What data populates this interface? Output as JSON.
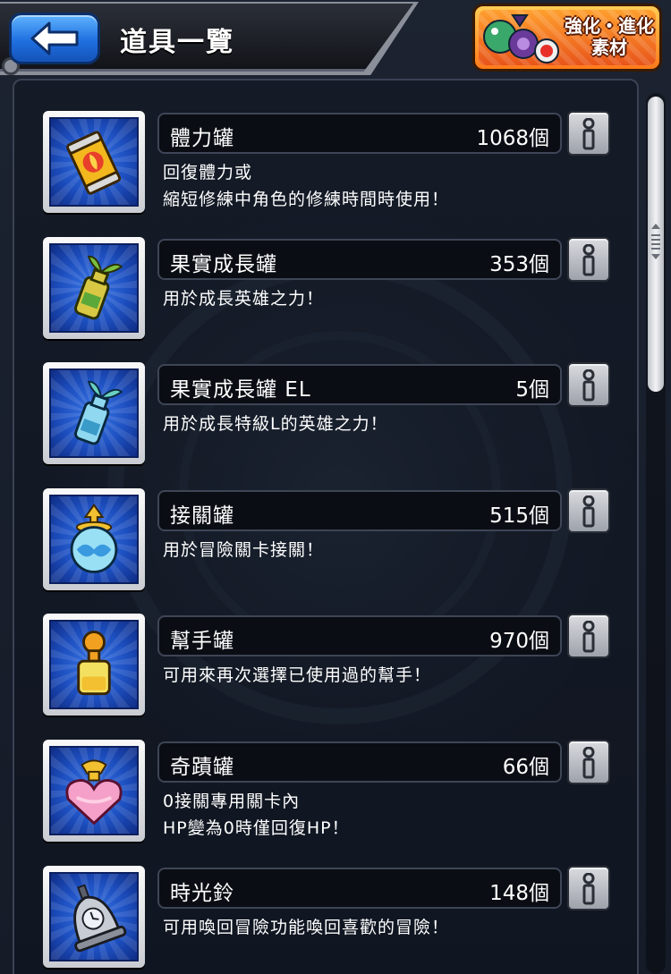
{
  "header": {
    "title": "道具一覽",
    "back_icon": "back-arrow-icon",
    "material_button": {
      "line1": "強化・進化",
      "line2": "素材"
    }
  },
  "items": [
    {
      "name": "體力罐",
      "count": "1068個",
      "desc": [
        "回復體力或",
        "縮短修練中角色的修練時間時使用！"
      ],
      "icon": "stamina-can-icon"
    },
    {
      "name": "果實成長罐",
      "count": "353個",
      "desc": [
        "用於成長英雄之力！"
      ],
      "icon": "fruit-growth-can-icon"
    },
    {
      "name": "果實成長罐 EL",
      "count": "5個",
      "desc": [
        "用於成長特級L的英雄之力！"
      ],
      "icon": "fruit-growth-can-el-icon"
    },
    {
      "name": "接關罐",
      "count": "515個",
      "desc": [
        "用於冒險關卡接關！"
      ],
      "icon": "continue-can-icon"
    },
    {
      "name": "幫手罐",
      "count": "970個",
      "desc": [
        "可用來再次選擇已使用過的幫手！"
      ],
      "icon": "helper-can-icon"
    },
    {
      "name": "奇蹟罐",
      "count": "66個",
      "desc": [
        "0接關專用關卡內",
        "HP變為0時僅回復HP！"
      ],
      "icon": "miracle-can-icon"
    },
    {
      "name": "時光鈴",
      "count": "148個",
      "desc": [
        "可用喚回冒險功能喚回喜歡的冒險！"
      ],
      "icon": "time-bell-icon"
    }
  ],
  "colors": {
    "background": "#141a26",
    "back_button": "#1f6fe0",
    "material_button": "#ff7a1a",
    "icon_tile": "#1d4fc0"
  }
}
